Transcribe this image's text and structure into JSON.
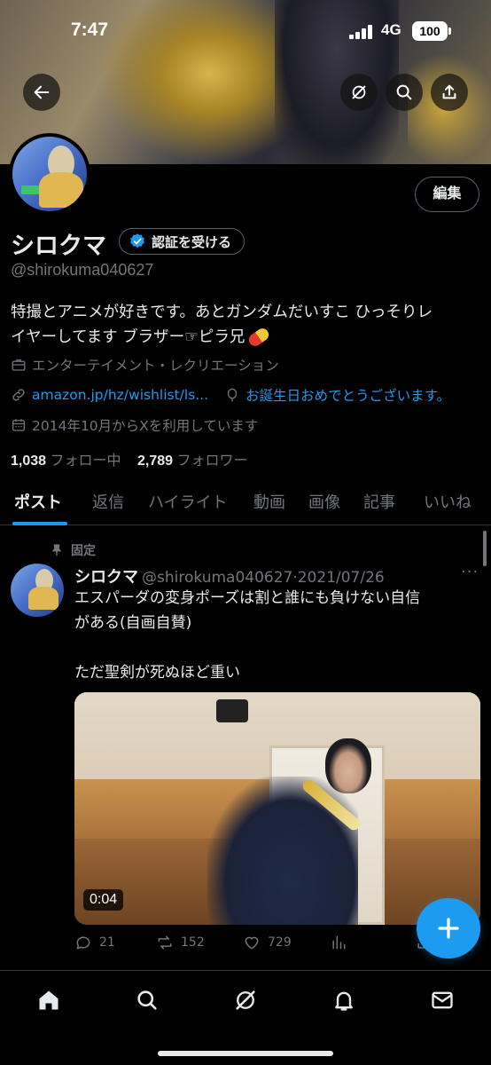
{
  "status_bar": {
    "time": "7:47",
    "network": "4G",
    "battery": "100"
  },
  "header": {
    "icons": [
      "back-arrow-icon",
      "grok-icon",
      "search-icon",
      "share-icon"
    ]
  },
  "profile": {
    "edit_label": "編集",
    "display_name": "シロクマ",
    "verify_label": "認証を受ける",
    "handle": "@shirokuma040627",
    "bio_line1": "特撮とアニメが好きです。あとガンダムだいすこ ひっそりレ",
    "bio_line2": "イヤーしてます ブラザー☞ピラ兄",
    "category": "エンターテイメント・レクリエーション",
    "link": "amazon.jp/hz/wishlist/ls...",
    "birthday": "お誕生日おめでとうございます。",
    "joined": "2014年10月からXを利用しています",
    "following_count": "1,038",
    "following_label": "フォロー中",
    "followers_count": "2,789",
    "followers_label": "フォロワー"
  },
  "tabs": [
    "ポスト",
    "返信",
    "ハイライト",
    "動画",
    "画像",
    "記事",
    "いいね"
  ],
  "active_tab": "ポスト",
  "post": {
    "pinned_label": "固定",
    "author": "シロクマ",
    "handle_date": "@shirokuma040627·2021/07/26",
    "more": "···",
    "text": "エスパーダの変身ポーズは割と誰にも負けない自信\nがある(自画自賛)\n\nただ聖剣が死ぬほど重い",
    "video_duration": "0:04",
    "replies": "21",
    "reposts": "152",
    "likes": "729"
  },
  "colors": {
    "accent": "#1d9bf0",
    "muted": "#71767b",
    "text": "#e7e9ea",
    "background": "#000000"
  }
}
